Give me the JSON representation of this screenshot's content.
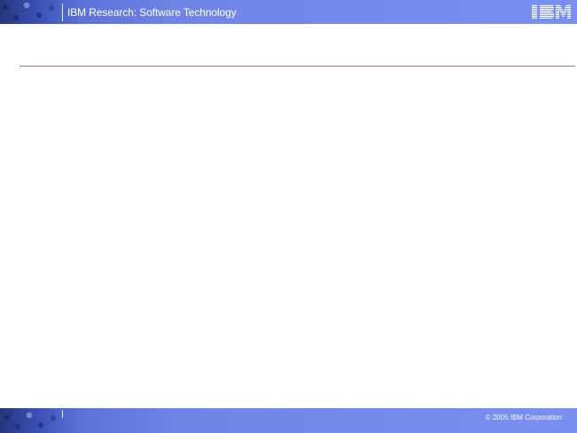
{
  "header": {
    "title": "IBM Research: Software Technology",
    "logo_text": "IBM"
  },
  "footer": {
    "copyright": "© 2005 IBM Corporation"
  },
  "colors": {
    "band_dark": "#27357e",
    "band_light": "#7a8ff0",
    "rule": "#b07a7a",
    "background": "#ffffff"
  }
}
